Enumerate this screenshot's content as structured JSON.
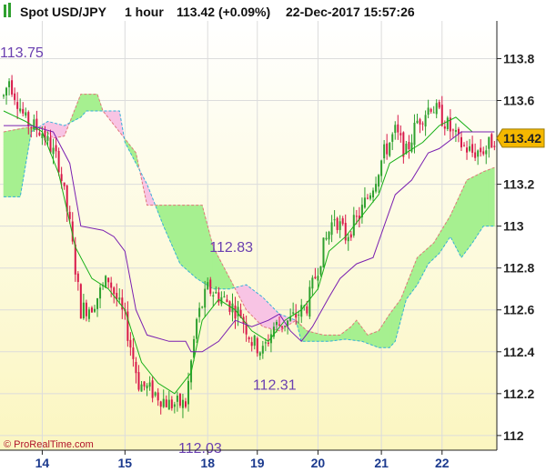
{
  "header": {
    "instrument": "Spot USD/JPY",
    "timeframe": "1 hour",
    "price_change": "113.42 (+0.09%)",
    "datetime": "22-Dec-2017 15:57:26"
  },
  "credit": "© ProRealTime.com",
  "colors": {
    "bull": "#2fa02f",
    "bear": "#d8194a",
    "tenkan": "#18b018",
    "kijun": "#7a1fb0",
    "cloud_bull": "#a6f090",
    "cloud_bear": "#f8c4e4",
    "span_a_line": "#e07878",
    "span_b_line": "#34b0d8",
    "price_box": "#f5b800"
  },
  "chart_data": {
    "type": "candlestick",
    "title": "Spot USD/JPY 1 hour",
    "ylim": [
      111.93,
      113.98
    ],
    "y_ticks": [
      113.8,
      113.6,
      113.2,
      113,
      112.8,
      112.6,
      112.4,
      112.2,
      112
    ],
    "y_tick_labels": [
      "113.8",
      "113.6",
      "113.2",
      "113",
      "112.8",
      "112.6",
      "112.4",
      "112.2",
      "112"
    ],
    "x_ticks": [
      {
        "label": "14",
        "bar": 14
      },
      {
        "label": "15",
        "bar": 44
      },
      {
        "label": "18",
        "bar": 74
      },
      {
        "label": "19",
        "bar": 92
      },
      {
        "label": "20",
        "bar": 114
      },
      {
        "label": "21",
        "bar": 137
      },
      {
        "label": "22",
        "bar": 159
      }
    ],
    "bar_count": 179,
    "last_price": "113.42",
    "annotations": [
      {
        "text": "113.75",
        "bar": 0,
        "price": 113.75
      },
      {
        "text": "112.83",
        "bar": 76,
        "price": 112.83
      },
      {
        "text": "112.31",
        "bar": 95,
        "price": 112.31
      },
      {
        "text": "112.03",
        "bar": 68,
        "price": 112.03
      }
    ],
    "close_path": [
      [
        0,
        113.62
      ],
      [
        2,
        113.7
      ],
      [
        8,
        113.5
      ],
      [
        14,
        113.45
      ],
      [
        20,
        113.3
      ],
      [
        24,
        113.0
      ],
      [
        28,
        112.6
      ],
      [
        32,
        112.62
      ],
      [
        38,
        112.75
      ],
      [
        44,
        112.55
      ],
      [
        49,
        112.25
      ],
      [
        55,
        112.2
      ],
      [
        60,
        112.15
      ],
      [
        66,
        112.15
      ],
      [
        70,
        112.55
      ],
      [
        74,
        112.7
      ],
      [
        80,
        112.65
      ],
      [
        86,
        112.58
      ],
      [
        90,
        112.45
      ],
      [
        94,
        112.4
      ],
      [
        98,
        112.52
      ],
      [
        104,
        112.55
      ],
      [
        110,
        112.62
      ],
      [
        116,
        112.9
      ],
      [
        120,
        113.05
      ],
      [
        124,
        112.95
      ],
      [
        129,
        113.05
      ],
      [
        134,
        113.2
      ],
      [
        138,
        113.35
      ],
      [
        142,
        113.45
      ],
      [
        146,
        113.35
      ],
      [
        150,
        113.5
      ],
      [
        155,
        113.58
      ],
      [
        160,
        113.5
      ],
      [
        165,
        113.4
      ],
      [
        170,
        113.35
      ],
      [
        175,
        113.37
      ],
      [
        178,
        113.42
      ]
    ],
    "tenkan": [
      [
        0,
        113.55
      ],
      [
        8,
        113.5
      ],
      [
        14,
        113.45
      ],
      [
        20,
        113.25
      ],
      [
        26,
        112.9
      ],
      [
        32,
        112.75
      ],
      [
        38,
        112.7
      ],
      [
        44,
        112.6
      ],
      [
        50,
        112.35
      ],
      [
        56,
        112.25
      ],
      [
        62,
        112.2
      ],
      [
        68,
        112.3
      ],
      [
        72,
        112.55
      ],
      [
        78,
        112.65
      ],
      [
        84,
        112.6
      ],
      [
        90,
        112.5
      ],
      [
        96,
        112.45
      ],
      [
        102,
        112.55
      ],
      [
        108,
        112.6
      ],
      [
        114,
        112.7
      ],
      [
        118,
        112.88
      ],
      [
        124,
        112.95
      ],
      [
        130,
        113.05
      ],
      [
        136,
        113.15
      ],
      [
        140,
        113.3
      ],
      [
        146,
        113.35
      ],
      [
        152,
        113.4
      ],
      [
        158,
        113.48
      ],
      [
        164,
        113.52
      ],
      [
        170,
        113.45
      ],
      [
        178,
        113.45
      ]
    ],
    "kijun": [
      [
        0,
        113.48
      ],
      [
        10,
        113.48
      ],
      [
        18,
        113.45
      ],
      [
        24,
        113.3
      ],
      [
        28,
        113.0
      ],
      [
        36,
        112.98
      ],
      [
        40,
        112.95
      ],
      [
        44,
        112.88
      ],
      [
        48,
        112.6
      ],
      [
        52,
        112.48
      ],
      [
        60,
        112.45
      ],
      [
        66,
        112.45
      ],
      [
        68,
        112.4
      ],
      [
        72,
        112.4
      ],
      [
        78,
        112.45
      ],
      [
        84,
        112.55
      ],
      [
        90,
        112.52
      ],
      [
        96,
        112.55
      ],
      [
        100,
        112.58
      ],
      [
        104,
        112.5
      ],
      [
        108,
        112.45
      ],
      [
        112,
        112.52
      ],
      [
        118,
        112.66
      ],
      [
        122,
        112.75
      ],
      [
        128,
        112.82
      ],
      [
        134,
        112.85
      ],
      [
        138,
        113.0
      ],
      [
        142,
        113.15
      ],
      [
        148,
        113.22
      ],
      [
        154,
        113.35
      ],
      [
        158,
        113.37
      ],
      [
        166,
        113.45
      ],
      [
        178,
        113.45
      ]
    ],
    "span_a": [
      [
        0,
        113.45
      ],
      [
        8,
        113.47
      ],
      [
        14,
        113.47
      ],
      [
        18,
        113.42
      ],
      [
        22,
        113.43
      ],
      [
        28,
        113.63
      ],
      [
        34,
        113.63
      ],
      [
        36,
        113.55
      ],
      [
        42,
        113.45
      ],
      [
        48,
        113.35
      ],
      [
        52,
        113.1
      ],
      [
        72,
        113.1
      ],
      [
        76,
        112.9
      ],
      [
        82,
        112.75
      ],
      [
        88,
        112.6
      ],
      [
        94,
        112.52
      ],
      [
        100,
        112.5
      ],
      [
        106,
        112.55
      ],
      [
        110,
        112.5
      ],
      [
        116,
        112.48
      ],
      [
        122,
        112.48
      ],
      [
        126,
        112.52
      ],
      [
        128,
        112.55
      ],
      [
        132,
        112.48
      ],
      [
        136,
        112.5
      ],
      [
        140,
        112.58
      ],
      [
        144,
        112.65
      ],
      [
        150,
        112.85
      ],
      [
        156,
        112.92
      ],
      [
        162,
        113.05
      ],
      [
        168,
        113.22
      ],
      [
        174,
        113.26
      ],
      [
        178,
        113.28
      ]
    ],
    "span_b": [
      [
        0,
        113.14
      ],
      [
        6,
        113.14
      ],
      [
        10,
        113.45
      ],
      [
        16,
        113.5
      ],
      [
        22,
        113.48
      ],
      [
        28,
        113.52
      ],
      [
        30,
        113.55
      ],
      [
        38,
        113.55
      ],
      [
        42,
        113.55
      ],
      [
        44,
        113.4
      ],
      [
        48,
        113.3
      ],
      [
        52,
        113.2
      ],
      [
        58,
        113.0
      ],
      [
        64,
        112.82
      ],
      [
        70,
        112.75
      ],
      [
        76,
        112.7
      ],
      [
        82,
        112.7
      ],
      [
        88,
        112.72
      ],
      [
        94,
        112.66
      ],
      [
        100,
        112.58
      ],
      [
        106,
        112.55
      ],
      [
        108,
        112.45
      ],
      [
        118,
        112.45
      ],
      [
        124,
        112.46
      ],
      [
        130,
        112.45
      ],
      [
        136,
        112.42
      ],
      [
        140,
        112.42
      ],
      [
        142,
        112.45
      ],
      [
        146,
        112.65
      ],
      [
        150,
        112.72
      ],
      [
        154,
        112.82
      ],
      [
        158,
        112.87
      ],
      [
        162,
        112.95
      ],
      [
        166,
        112.85
      ],
      [
        170,
        112.92
      ],
      [
        174,
        113.0
      ],
      [
        178,
        113.0
      ]
    ]
  }
}
